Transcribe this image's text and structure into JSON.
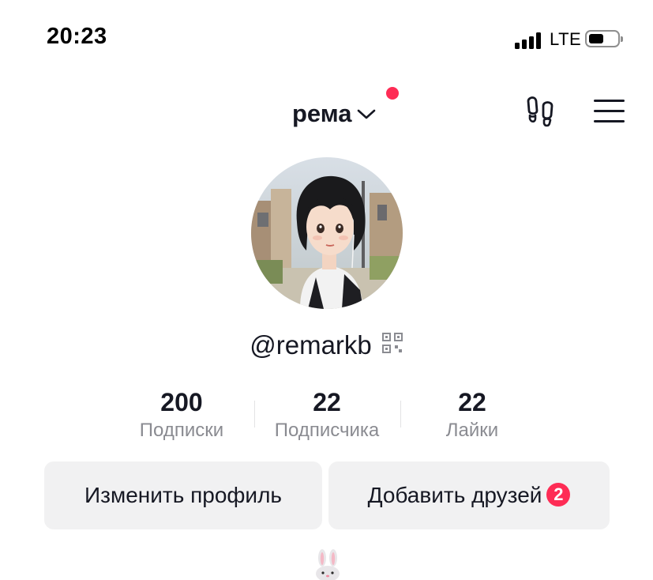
{
  "status_bar": {
    "time": "20:23",
    "network": "LTE",
    "signal_bars": 4,
    "battery_level": 0.45
  },
  "header": {
    "username": "рема",
    "chevron_icon": "chevron-down-icon",
    "has_notification_dot": true,
    "notification_dot_color": "#fe2c55",
    "footprint_icon": "footprint-icon",
    "menu_icon": "hamburger-menu-icon"
  },
  "profile": {
    "avatar": "illustrated-girl-avatar",
    "handle": "@remarkb",
    "qr_icon": "qr-code-icon"
  },
  "stats": [
    {
      "value": "200",
      "label": "Подписки"
    },
    {
      "value": "22",
      "label": "Подписчика"
    },
    {
      "value": "22",
      "label": "Лайки"
    }
  ],
  "actions": {
    "edit_profile": "Изменить профиль",
    "add_friends": "Добавить друзей",
    "add_friends_badge": "2"
  },
  "bio": {
    "emoji": "rabbit-face-emoji"
  },
  "colors": {
    "accent": "#fe2c55",
    "text_primary": "#161823",
    "text_secondary": "#8a8b91",
    "button_bg": "#f1f1f2"
  }
}
